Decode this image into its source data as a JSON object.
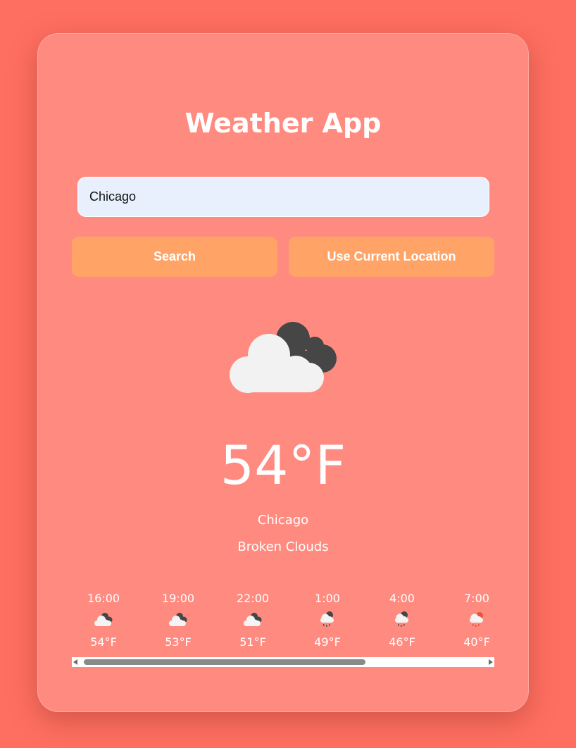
{
  "app": {
    "title": "Weather App"
  },
  "search": {
    "value": "Chicago",
    "search_label": "Search",
    "location_label": "Use Current Location"
  },
  "current": {
    "icon": "broken-clouds-icon",
    "temperature": "54°F",
    "city": "Chicago",
    "description": "Broken Clouds"
  },
  "forecast": [
    {
      "time": "16:00",
      "icon": "broken-clouds-icon",
      "temp": "54°F"
    },
    {
      "time": "19:00",
      "icon": "broken-clouds-icon",
      "temp": "53°F"
    },
    {
      "time": "22:00",
      "icon": "broken-clouds-icon",
      "temp": "51°F"
    },
    {
      "time": "1:00",
      "icon": "rain-cloud-icon",
      "temp": "49°F"
    },
    {
      "time": "4:00",
      "icon": "rain-cloud-icon",
      "temp": "46°F"
    },
    {
      "time": "7:00",
      "icon": "rain-cloud-sun-icon",
      "temp": "40°F"
    }
  ],
  "colors": {
    "background": "#ff6f61",
    "card": "#ff8b80",
    "button": "#ffa466",
    "input": "#e8f0fe"
  }
}
